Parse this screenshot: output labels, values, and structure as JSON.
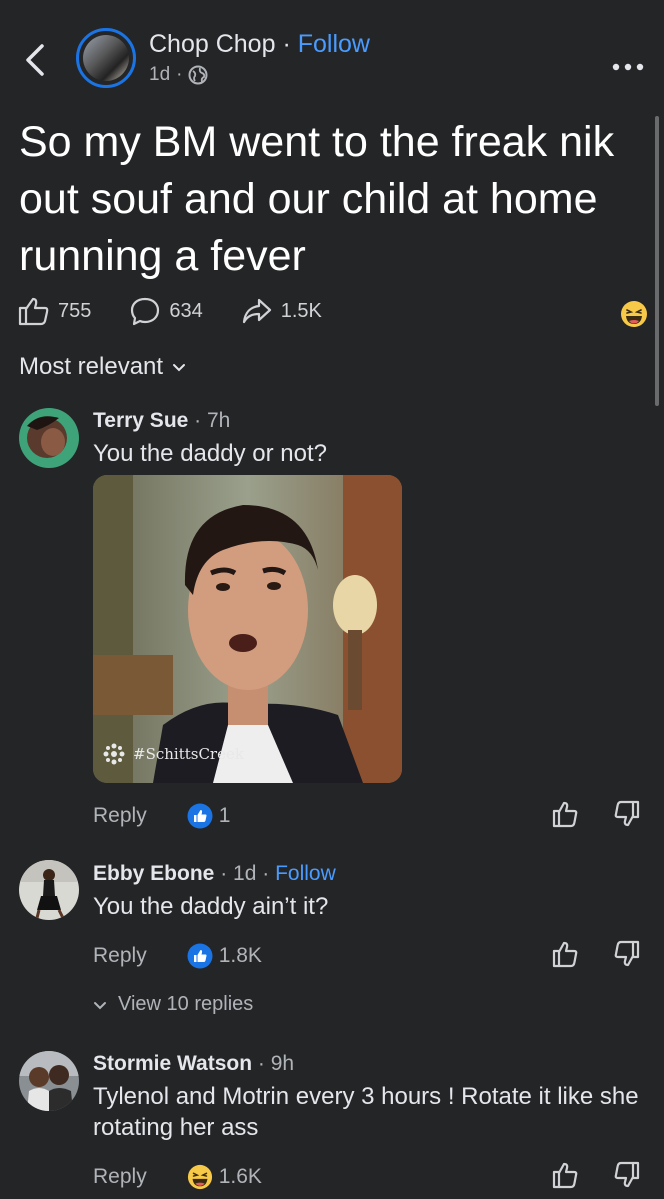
{
  "post": {
    "author": "Chop Chop",
    "separator": "·",
    "follow_label": "Follow",
    "age": "1d",
    "age_separator": "·",
    "text": "So my BM went to the freak nik out souf and our child at home running a fever",
    "likes": "755",
    "comments": "634",
    "shares": "1.5K"
  },
  "sort": {
    "label": "Most relevant"
  },
  "comments": [
    {
      "name": "Terry Sue",
      "time": "· 7h",
      "text": "You the daddy or not?",
      "gif_tag": "#SchittsCreek",
      "reply_label": "Reply",
      "reaction_count": "1"
    },
    {
      "name": "Ebby Ebone",
      "time": "· 1d ·",
      "follow_label": "Follow",
      "text": "You the daddy ain’t it?",
      "reply_label": "Reply",
      "reaction_count": "1.8K",
      "view_replies": "View 10 replies"
    },
    {
      "name": "Stormie Watson",
      "time": "· 9h",
      "text": "Tylenol and Motrin every 3 hours ! Rotate it like she rotating her ass",
      "reply_label": "Reply",
      "reaction_count": "1.6K"
    }
  ],
  "colors": {
    "background": "#242526",
    "accent": "#4a9bff",
    "like_blue": "#1b74e4",
    "muted": "#b0b3b8"
  },
  "icons": [
    "back-chevron-icon",
    "globe-icon",
    "more-icon",
    "like-icon",
    "comment-icon",
    "share-icon",
    "laugh-emoji-icon",
    "chevron-down-icon",
    "dislike-icon",
    "like-reaction-icon"
  ]
}
